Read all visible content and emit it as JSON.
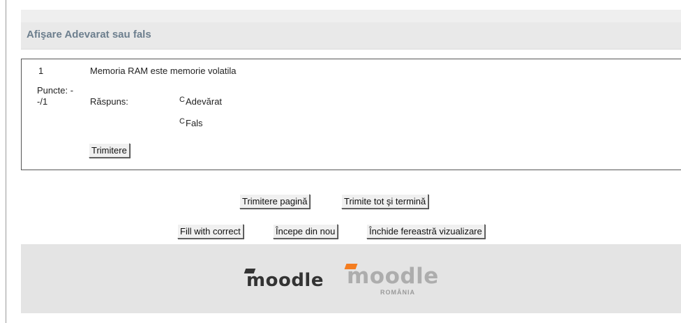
{
  "header": {
    "title": "Afişare Adevarat sau fals"
  },
  "question": {
    "number": "1",
    "text": "Memoria RAM este memorie volatila",
    "puncte_label": "Puncte: -",
    "puncte_value": "-/1",
    "answer_label": "Răspuns:",
    "options": [
      "Adevărat",
      "Fals"
    ],
    "radio_glyph": "C",
    "submit_label": "Trimitere"
  },
  "actions": {
    "submit_page": "Trimitere pagină",
    "submit_all": "Trimite tot şi termină",
    "fill_correct": "Fill with correct",
    "restart": "Începe din nou",
    "close_preview": "Închide fereastră vizualizare"
  },
  "footer": {
    "logo_text": "moodle",
    "logo2_text": "moodle",
    "logo2_sub": "ROMÂNIA",
    "accent": "#f47d20"
  }
}
